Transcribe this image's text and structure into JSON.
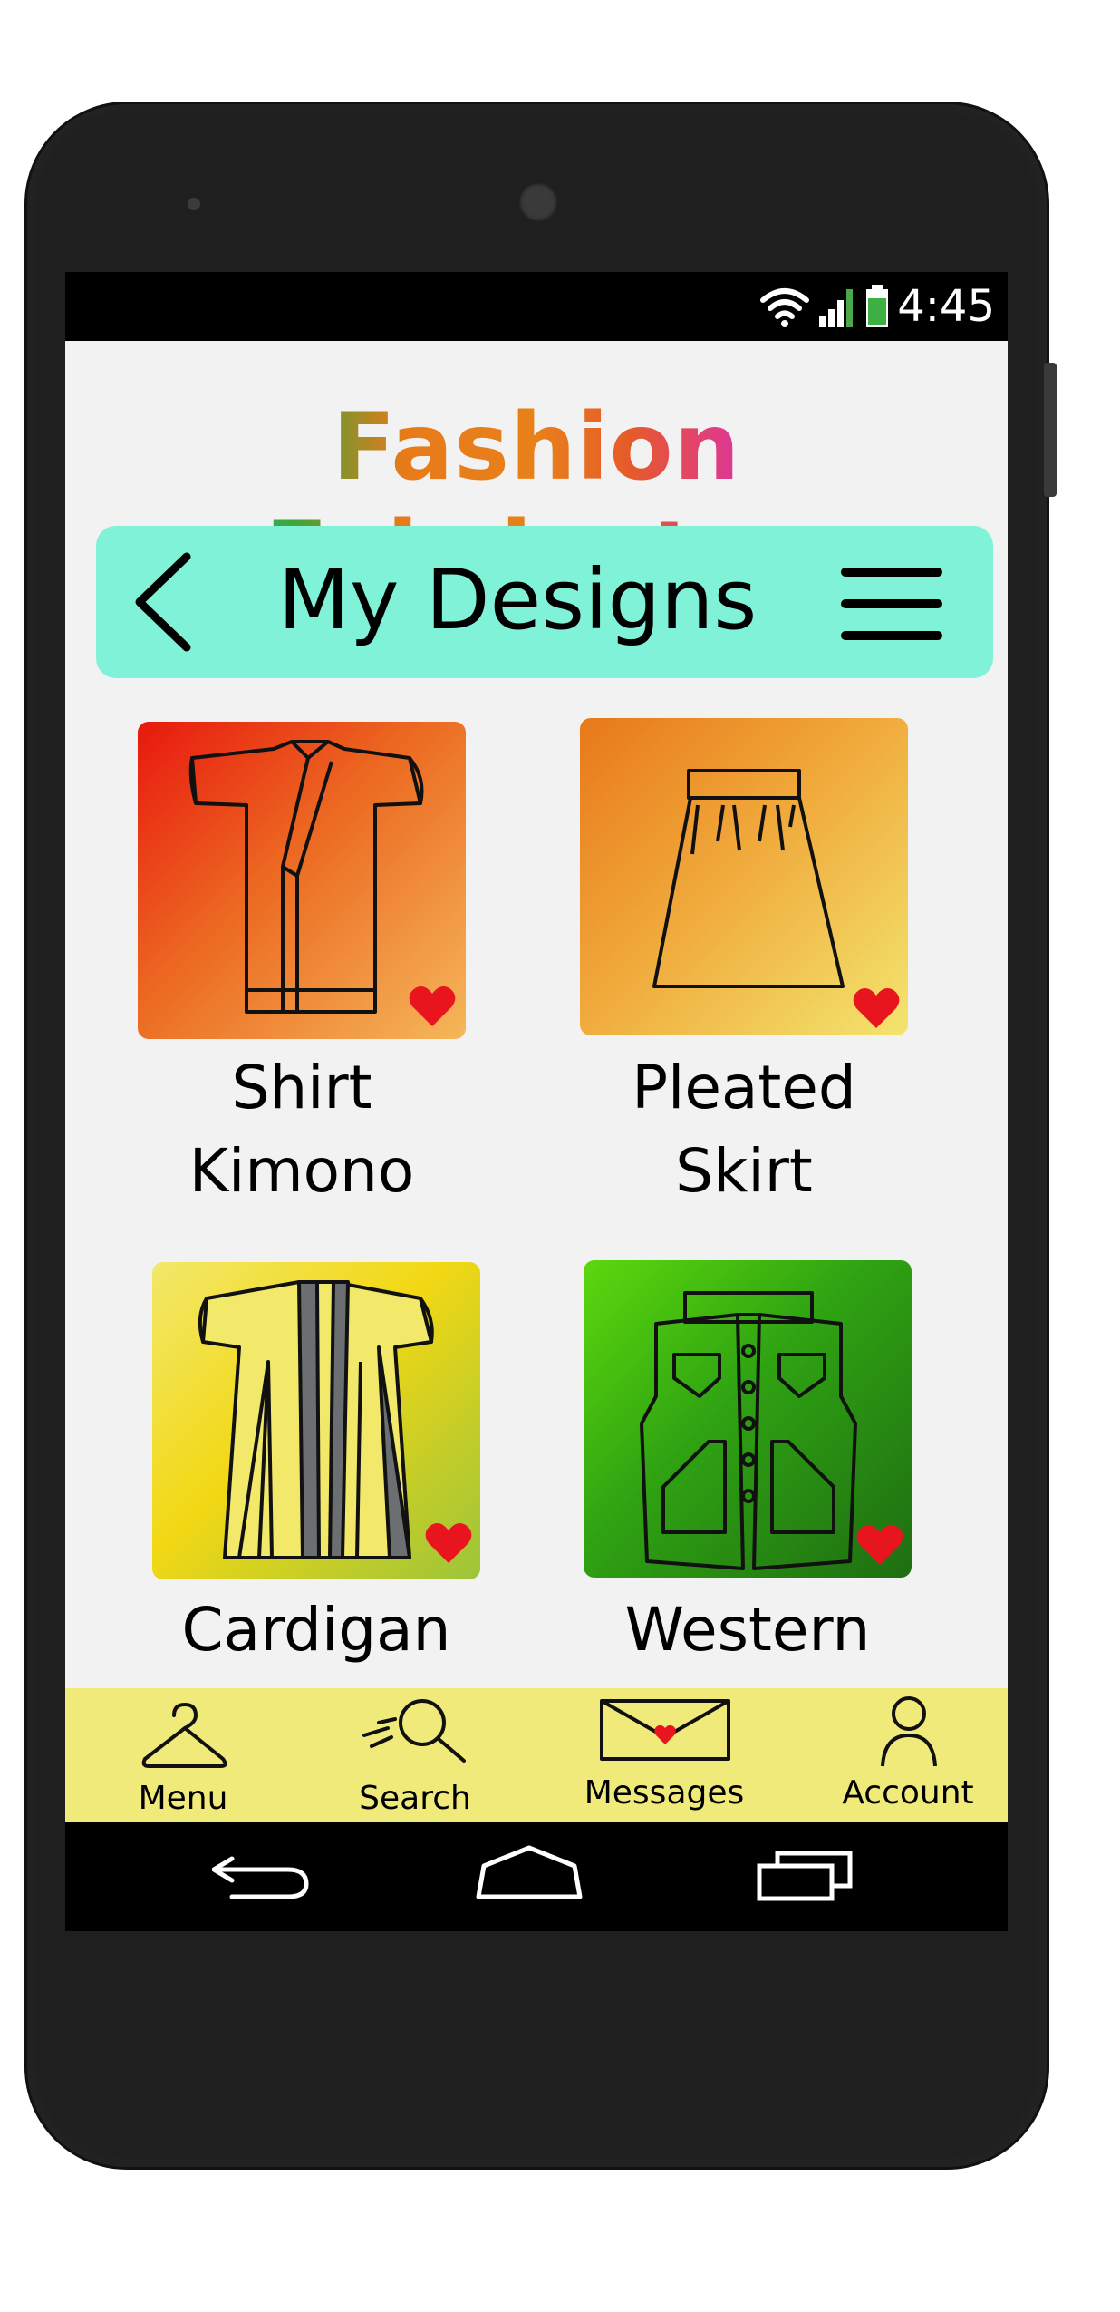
{
  "status_bar": {
    "time": "4:45",
    "icons": [
      "wifi-icon",
      "signal-icon",
      "battery-icon"
    ]
  },
  "app": {
    "title": "Fashion Fabricator"
  },
  "navbar": {
    "title": "My Designs",
    "back_icon": "chevron-left-icon",
    "menu_icon": "hamburger-menu-icon",
    "color": "#7ff2d8"
  },
  "designs": [
    {
      "line1": "Shirt",
      "line2": "Kimono",
      "favorite": true,
      "icon": "kimono-icon"
    },
    {
      "line1": "Pleated",
      "line2": "Skirt",
      "favorite": true,
      "icon": "skirt-icon"
    },
    {
      "line1": "Cardigan",
      "line2": "",
      "favorite": true,
      "icon": "cardigan-icon"
    },
    {
      "line1": "Western",
      "line2": "",
      "favorite": true,
      "icon": "vest-icon"
    }
  ],
  "bottom_nav": {
    "items": [
      {
        "label": "Menu",
        "icon": "hanger-icon"
      },
      {
        "label": "Search",
        "icon": "magnifier-icon"
      },
      {
        "label": "Messages",
        "icon": "envelope-heart-icon"
      },
      {
        "label": "Account",
        "icon": "person-icon"
      }
    ],
    "color": "#f0ea7a"
  },
  "system_nav": {
    "items": [
      "back-arrow-icon",
      "home-icon",
      "recent-apps-icon"
    ]
  },
  "colors": {
    "favorite": "#e8141e",
    "phone_body": "#1f1f1f"
  }
}
